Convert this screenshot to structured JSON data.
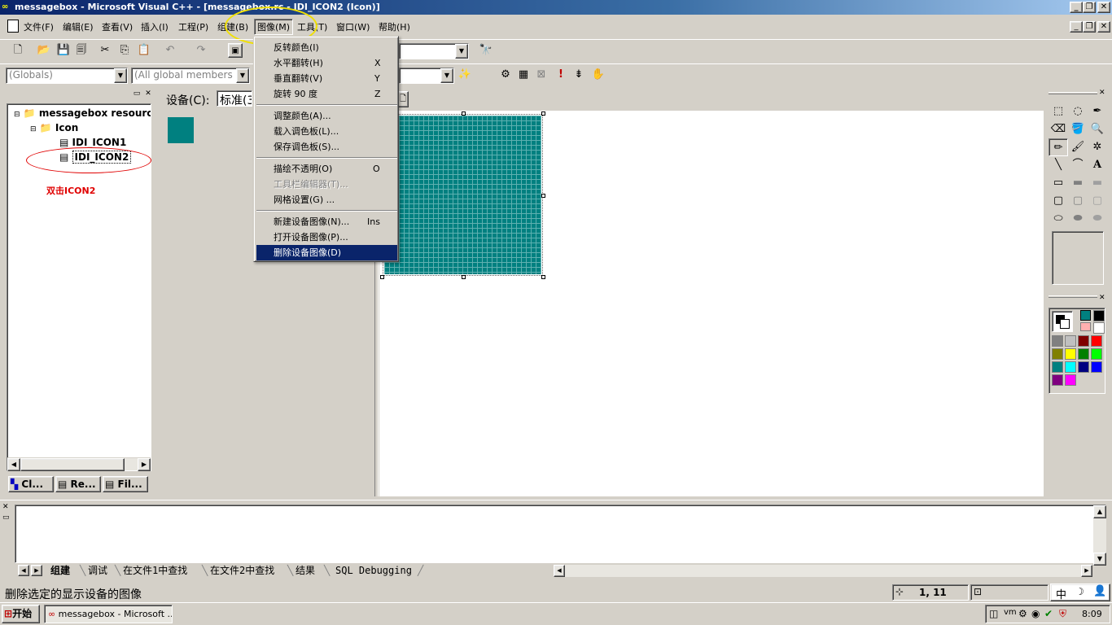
{
  "window": {
    "title": "messagebox - Microsoft Visual C++ - [messagebox.rc - IDI_ICON2 (Icon)]",
    "minimize": "_",
    "restore": "❐",
    "close": "✕"
  },
  "menu": {
    "items": [
      "文件(F)",
      "编辑(E)",
      "查看(V)",
      "插入(I)",
      "工程(P)",
      "组建(B)",
      "图像(M)",
      "工具(T)",
      "窗口(W)",
      "帮助(H)"
    ]
  },
  "toolbar": {
    "globals_combo": "(Globals)",
    "members_combo": "(All global members",
    "find_combo": ""
  },
  "image_menu": {
    "items": [
      {
        "label": "反转颜色(I)",
        "shortcut": ""
      },
      {
        "label": "水平翻转(H)",
        "shortcut": "X"
      },
      {
        "label": "垂直翻转(V)",
        "shortcut": "Y"
      },
      {
        "label": "旋转 90 度",
        "shortcut": "Z"
      },
      {
        "label": "调整颜色(A)...",
        "shortcut": ""
      },
      {
        "label": "载入调色板(L)...",
        "shortcut": ""
      },
      {
        "label": "保存调色板(S)...",
        "shortcut": ""
      },
      {
        "label": "描绘不透明(O)",
        "shortcut": "O"
      },
      {
        "label": "工具栏编辑器(T)...",
        "shortcut": ""
      },
      {
        "label": "网格设置(G) ...",
        "shortcut": ""
      },
      {
        "label": "新建设备图像(N)...",
        "shortcut": "Ins"
      },
      {
        "label": "打开设备图像(P)...",
        "shortcut": ""
      },
      {
        "label": "删除设备图像(D)",
        "shortcut": ""
      }
    ]
  },
  "workspace": {
    "tree": {
      "root": "messagebox resources",
      "folder": "Icon",
      "items": [
        "IDI_ICON1",
        "IDI_ICON2"
      ]
    },
    "annotation": "双击ICON2",
    "tabs": [
      "Cl...",
      "Re...",
      "Fil..."
    ]
  },
  "editor": {
    "device_label": "设备(C):",
    "device_value": "标准(3"
  },
  "output": {
    "tabs": [
      "组建",
      "调试",
      "在文件1中查找",
      "在文件2中查找",
      "结果",
      "SQL Debugging"
    ]
  },
  "status": {
    "message": "删除选定的显示设备的图像",
    "position": "1, 11",
    "ime": "中"
  },
  "taskbar": {
    "start": "开始",
    "task": "messagebox - Microsoft ...",
    "clock": "8:09"
  },
  "colors": {
    "titlebar": "#0a246a",
    "teal": "#008080",
    "highlight": "#0a246a",
    "annotation": "#e00000"
  },
  "palette": [
    "#808080",
    "#c0c0c0",
    "#800000",
    "#ff0000",
    "#808000",
    "#ffff00",
    "#008000",
    "#00ff00",
    "#008080",
    "#00ffff",
    "#000080",
    "#0000ff",
    "#800080",
    "#ff00ff"
  ]
}
